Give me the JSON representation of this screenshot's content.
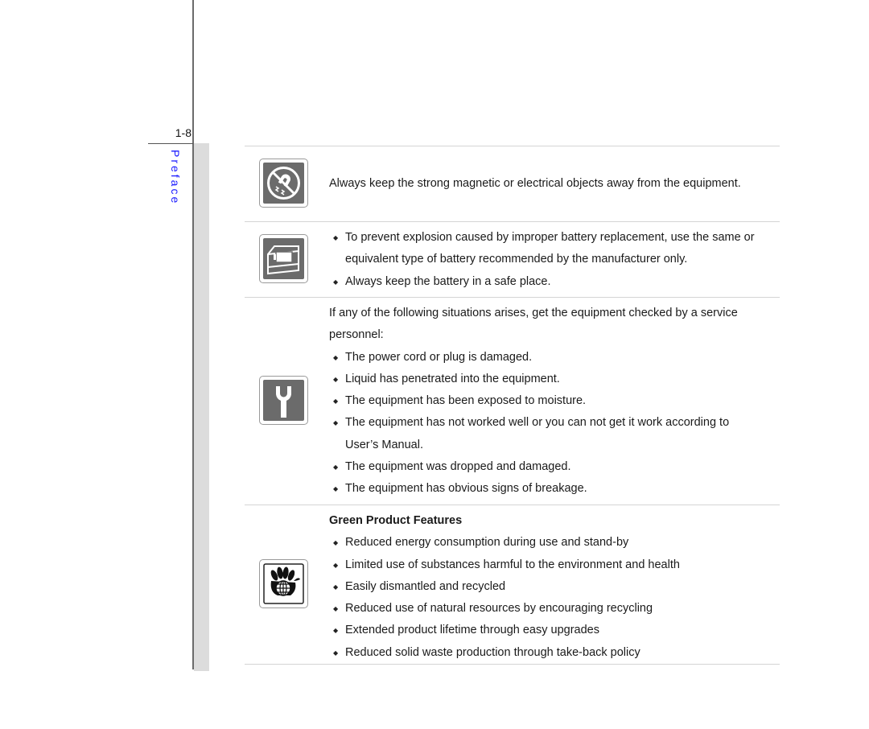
{
  "page": {
    "number": "1-8",
    "section": "Preface"
  },
  "blocks": [
    {
      "icon": "no-magnet-icon",
      "paragraph": "Always keep the strong magnetic or electrical objects away from the equipment."
    },
    {
      "icon": "battery-box-icon",
      "bullets": [
        "To prevent explosion caused by improper battery replacement, use the same or equivalent type of battery recommended by the manufacturer only.",
        "Always keep the battery in a safe place."
      ]
    },
    {
      "icon": "wrench-icon",
      "paragraph": "If any of the following situations arises, get the equipment checked by a service personnel:",
      "bullets": [
        "The power cord or plug is damaged.",
        "Liquid has penetrated into the equipment.",
        "The equipment has been exposed to moisture.",
        "The equipment has not worked well or you can not get it work according to User’s Manual.",
        "The equipment was dropped and damaged.",
        "The equipment has obvious signs of breakage."
      ]
    },
    {
      "icon": "green-globe-hand-icon",
      "heading": "Green Product Features",
      "bullets": [
        "Reduced energy consumption during use and stand-by",
        "Limited use of substances harmful to the environment and health",
        "Easily dismantled and recycled",
        "Reduced use of natural resources by encouraging recycling",
        "Extended product lifetime through easy upgrades",
        "Reduced solid waste production through take-back policy"
      ]
    }
  ],
  "colors": {
    "section_label": "#1a1aff",
    "icon_fill": "#6b6b6b",
    "rule": "#d4d4d4"
  }
}
